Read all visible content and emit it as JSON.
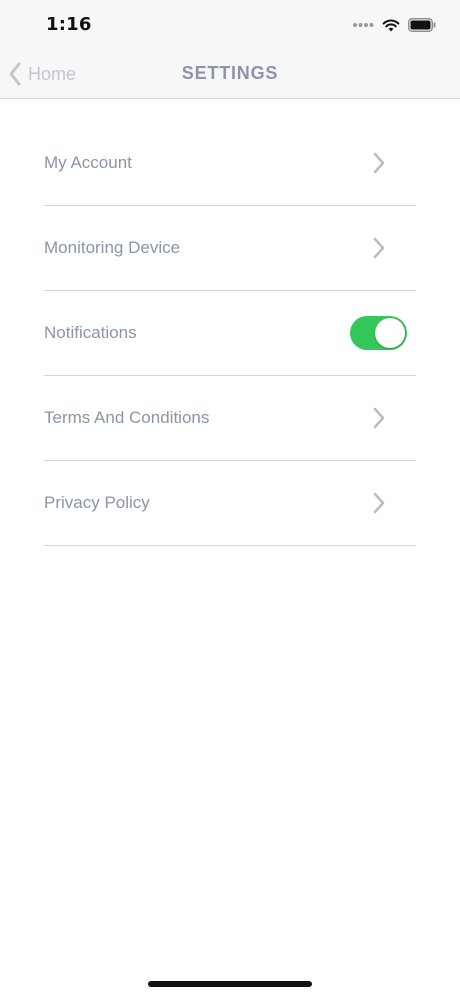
{
  "status_bar": {
    "time": "1:16",
    "icons": [
      "signal-dots-icon",
      "wifi-icon",
      "battery-icon"
    ]
  },
  "nav": {
    "back_label": "Home",
    "title": "SETTINGS"
  },
  "settings": {
    "items": [
      {
        "label": "My Account",
        "control": "chevron"
      },
      {
        "label": "Monitoring Device",
        "control": "chevron"
      },
      {
        "label": "Notifications",
        "control": "toggle",
        "toggle_on": true
      },
      {
        "label": "Terms And Conditions",
        "control": "chevron"
      },
      {
        "label": "Privacy Policy",
        "control": "chevron"
      }
    ]
  },
  "colors": {
    "text": "#8b95a8",
    "back_text": "#c2c7cf",
    "divider": "#cbd7e6",
    "toggle_on": "#34c759",
    "chevron": "#b7bcc5"
  }
}
